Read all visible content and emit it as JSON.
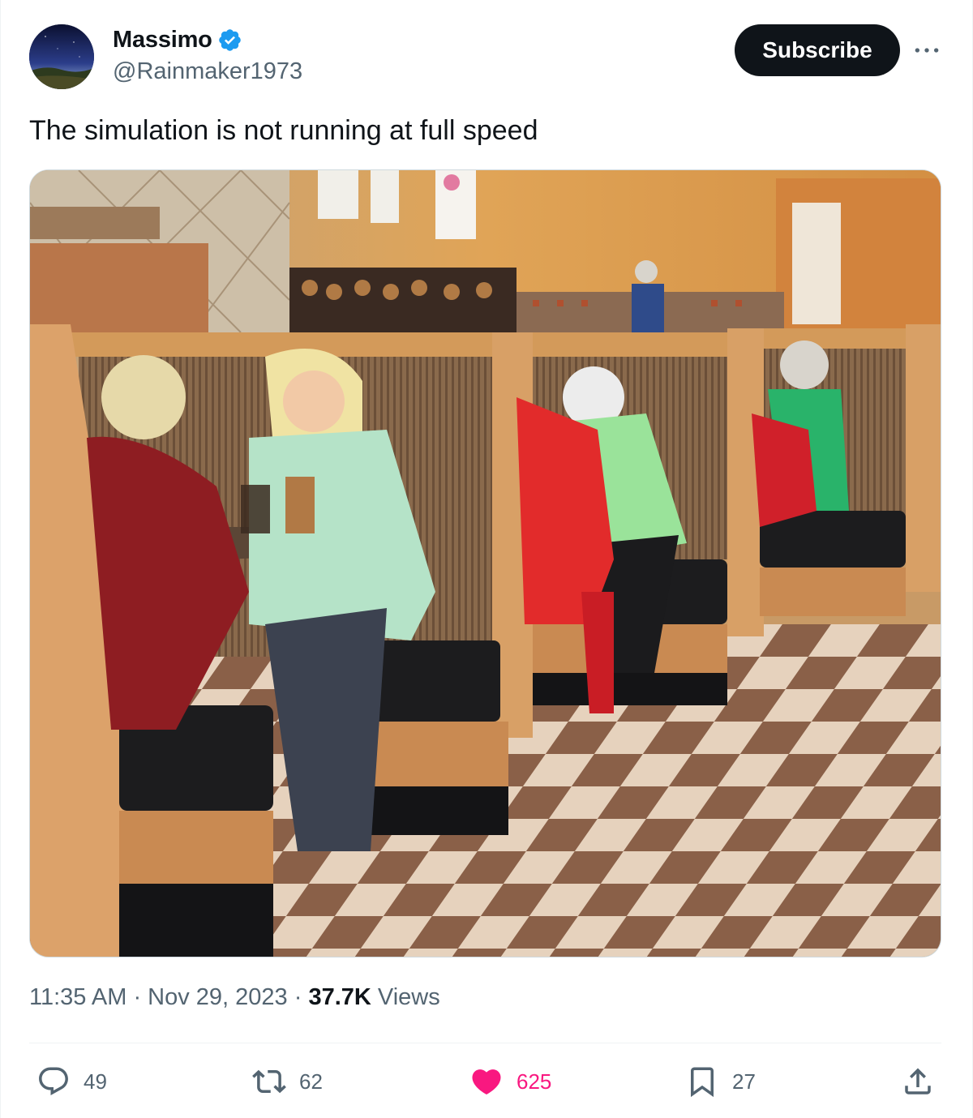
{
  "author": {
    "name": "Massimo",
    "handle": "@Rainmaker1973",
    "verified": true
  },
  "subscribe_label": "Subscribe",
  "tweet": {
    "text": "The simulation is not running at full speed"
  },
  "meta": {
    "time": "11:35 AM",
    "separator1": " · ",
    "date": "Nov 29, 2023",
    "separator2": " · ",
    "views_count": "37.7K",
    "views_label": " Views"
  },
  "actions": {
    "replies": "49",
    "reposts": "62",
    "likes": "625",
    "bookmarks": "27"
  },
  "colors": {
    "accent": "#1d9bf0",
    "like": "#f91880",
    "muted": "#536471",
    "text": "#0f1419"
  },
  "icons": {
    "reply": "speech-bubble-icon",
    "repost": "repost-arrows-icon",
    "like": "heart-icon",
    "bookmark": "bookmark-icon",
    "share": "share-upload-icon",
    "more": "ellipsis-icon",
    "verified": "verified-badge-icon"
  }
}
